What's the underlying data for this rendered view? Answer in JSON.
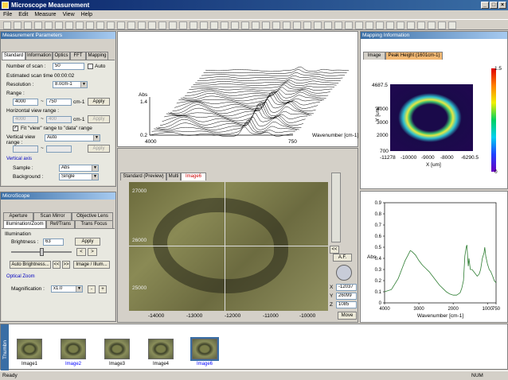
{
  "app": {
    "title": "Microscope Measurement"
  },
  "menu": [
    "File",
    "Edit",
    "Measure",
    "View",
    "Help"
  ],
  "meas": {
    "header": "Measurement Parameters",
    "tabs": [
      "Standard",
      "Information",
      "Optics",
      "FFT",
      "Mapping"
    ],
    "num_scan_label": "Number of scan :",
    "num_scan": "50",
    "auto_label": "Auto",
    "est_time_label": "Estimated scan time",
    "est_time": "00:00:02",
    "resolution_label": "Resolution :",
    "resolution": "8.0cm-1",
    "range_label": "Range :",
    "range_from": "4000",
    "range_to": "750",
    "range_unit": "cm-1",
    "apply": "Apply",
    "hview_label": "Horizontal view range :",
    "hview_from": "4000",
    "hview_to": "400",
    "hview_unit": "cm-1",
    "fit_label": "Fit \"view\" range to \"data\" range",
    "vview_label": "Vertical view range :",
    "vview": "Auto",
    "vertical_axis_label": "Vertical axis",
    "sample_label": "Sample :",
    "sample": "Abs",
    "background_label": "Background :",
    "background": "Single"
  },
  "microscope": {
    "header": "MicroScope",
    "tabs_top": [
      "Aperture",
      "Scan Mirror",
      "Objective Lens"
    ],
    "tabs_bottom": [
      "Illumination/Zoom",
      "Ref/Trans",
      "Trans Focus"
    ],
    "illum_label": "Illumination",
    "brightness_label": "Brightness :",
    "brightness": "63",
    "brightness_frac": 0.5,
    "apply": "Apply",
    "auto_bright": "Auto Brightness...",
    "image_illum": "Image / Illum...",
    "zoom_label": "Optical Zoom",
    "mag_label": "Magnification :",
    "mag": "x1.0"
  },
  "waterfall": {
    "ylabel": "Abs",
    "y_top": "1.4",
    "y_bottom": "0.2",
    "x_left": "4000",
    "x_right": "750",
    "xlabel": "Wavenumber [cm-1]"
  },
  "image_view": {
    "tabs": [
      "Standard (Preview)",
      "Multi",
      "Image6"
    ],
    "x_ticks": [
      "-14000",
      "-13000",
      "-12000",
      "-11000",
      "-10000"
    ],
    "y_ticks": [
      "27000",
      "26000",
      "25000"
    ],
    "coord_x_label": "X",
    "coord_x": "-12037",
    "coord_y_label": "Y",
    "coord_y": "26099",
    "coord_z_label": "Z",
    "coord_z": "1085",
    "af_label": "A.F.",
    "move": "Move"
  },
  "mapping": {
    "header": "Mapping Information",
    "tabs": [
      "Image",
      "Peak Height (1601cm-1)"
    ],
    "ylabel": "Y [um]",
    "xlabel": "X [um]",
    "y_ticks": [
      "4687.5",
      "4000",
      "3000",
      "2000",
      "700"
    ],
    "x_ticks": [
      "-11278",
      "-10000",
      "-9000",
      "-8000",
      "-6290.5"
    ],
    "cb_max": "1.5",
    "cb_min": "0"
  },
  "chart_data": {
    "type": "line",
    "ylabel": "Abs",
    "xlabel": "Wavenumber [cm-1]",
    "xlim": [
      4000,
      750
    ],
    "ylim": [
      0,
      0.9
    ],
    "x_ticks": [
      "4000",
      "3000",
      "2000",
      "1000",
      "750"
    ],
    "y_ticks": [
      "0.9",
      "0.8",
      "0.7",
      "0.6",
      "0.5",
      "0.4",
      "0.3",
      "0.2",
      "0.1",
      "0"
    ],
    "x": [
      4000,
      3800,
      3600,
      3500,
      3400,
      3300,
      3250,
      3200,
      3100,
      3000,
      2900,
      2800,
      2700,
      2600,
      2500,
      2400,
      2300,
      2200,
      2100,
      2000,
      1900,
      1800,
      1750,
      1700,
      1660,
      1620,
      1600,
      1560,
      1540,
      1500,
      1450,
      1400,
      1300,
      1240,
      1200,
      1150,
      1100,
      1080,
      1050,
      1000,
      950,
      900,
      850,
      800,
      750
    ],
    "y": [
      0.1,
      0.12,
      0.22,
      0.3,
      0.38,
      0.44,
      0.47,
      0.46,
      0.43,
      0.38,
      0.34,
      0.31,
      0.28,
      0.24,
      0.2,
      0.16,
      0.13,
      0.1,
      0.08,
      0.07,
      0.07,
      0.09,
      0.13,
      0.2,
      0.42,
      0.5,
      0.52,
      0.33,
      0.4,
      0.3,
      0.3,
      0.28,
      0.24,
      0.26,
      0.3,
      0.4,
      0.45,
      0.5,
      0.42,
      0.35,
      0.3,
      0.28,
      0.24,
      0.2,
      0.18
    ]
  },
  "thumbs": [
    "Image1",
    "Image2",
    "Image3",
    "Image4",
    "Image6"
  ],
  "thumb_panel_label": "Thumbn",
  "status": {
    "left": "Ready",
    "num": "NUM"
  }
}
